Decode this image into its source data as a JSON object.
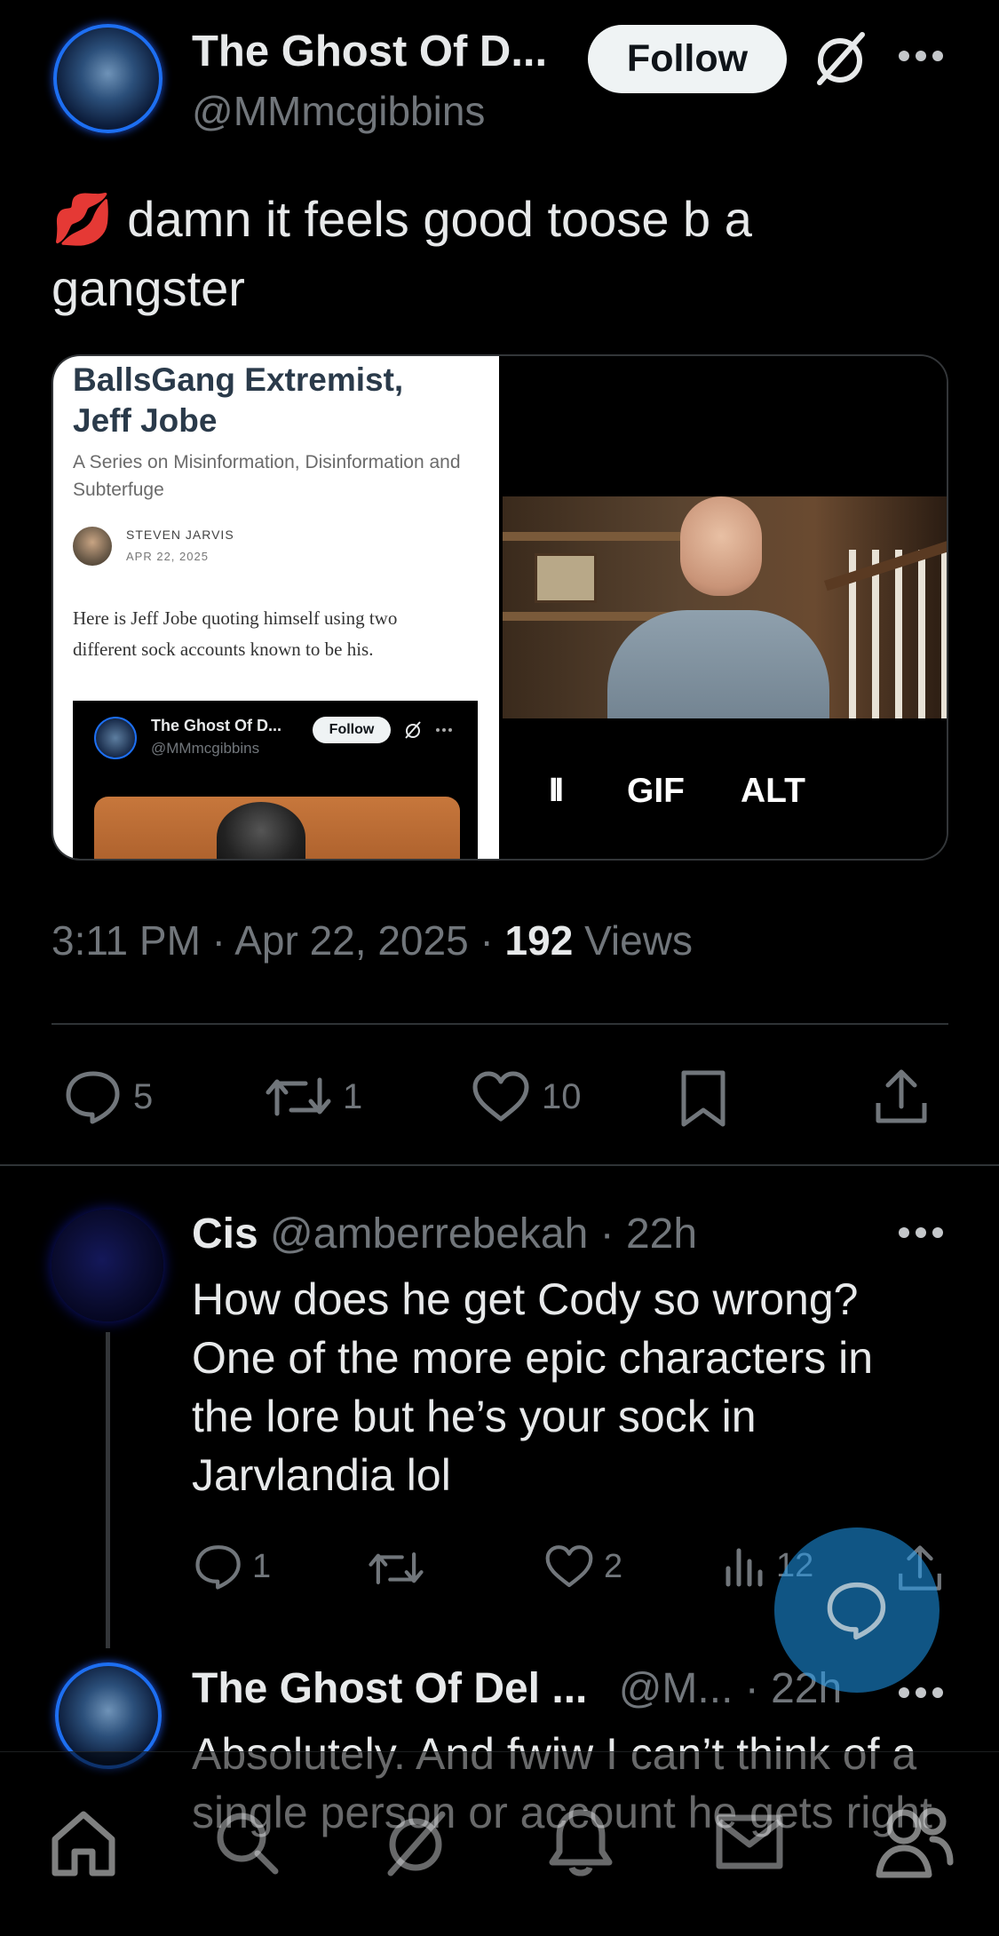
{
  "post": {
    "display_name": "The Ghost Of D...",
    "handle": "@MMmcgibbins",
    "follow_label": "Follow",
    "emoji": "💋",
    "text": "damn it feels good toose b a gangster",
    "timestamp": "3:11 PM · Apr 22, 2025 · ",
    "views_count": "192",
    "views_label": " Views",
    "stats": {
      "replies": "5",
      "reposts": "1",
      "likes": "10"
    }
  },
  "media_left": {
    "title": "BallsGang Extremist, Jeff Jobe",
    "subtitle": "A Series on Misinformation, Disinformation and Subterfuge",
    "author": "STEVEN JARVIS",
    "date": "APR 22, 2025",
    "body": "Here is Jeff Jobe quoting himself using two different sock accounts known to be his.",
    "embed_name": "The Ghost Of D...",
    "embed_handle": "@MMmcgibbins",
    "embed_follow": "Follow"
  },
  "media_right": {
    "pause_label": "II",
    "gif_label": "GIF",
    "alt_label": "ALT"
  },
  "reply1": {
    "name": "Cis",
    "handle": "@amberrebekah",
    "time": " · 22h",
    "text": "How does he get Cody so wrong? One of the more epic characters in the lore but he’s your sock in Jarvlandia lol",
    "replies": "1",
    "likes": "2",
    "views": "12"
  },
  "reply2": {
    "name": "The Ghost Of Del ...",
    "handle": "@M...",
    "time": " · 22h",
    "text": "Absolutely. And fwiw I can’t think of a single person or account he gets right"
  },
  "colors": {
    "accent": "#1d9bf0",
    "background": "#000000",
    "muted": "#71767b"
  },
  "icons": {
    "more": "more-icon",
    "grok": "grok-icon",
    "reply": "reply-icon",
    "repost": "repost-icon",
    "like": "like-icon",
    "bookmark": "bookmark-icon",
    "share": "share-icon",
    "views": "views-icon",
    "compose": "compose-icon",
    "home": "home-icon",
    "search": "search-icon",
    "notifications": "bell-icon",
    "messages": "mail-icon",
    "communities": "communities-icon"
  }
}
